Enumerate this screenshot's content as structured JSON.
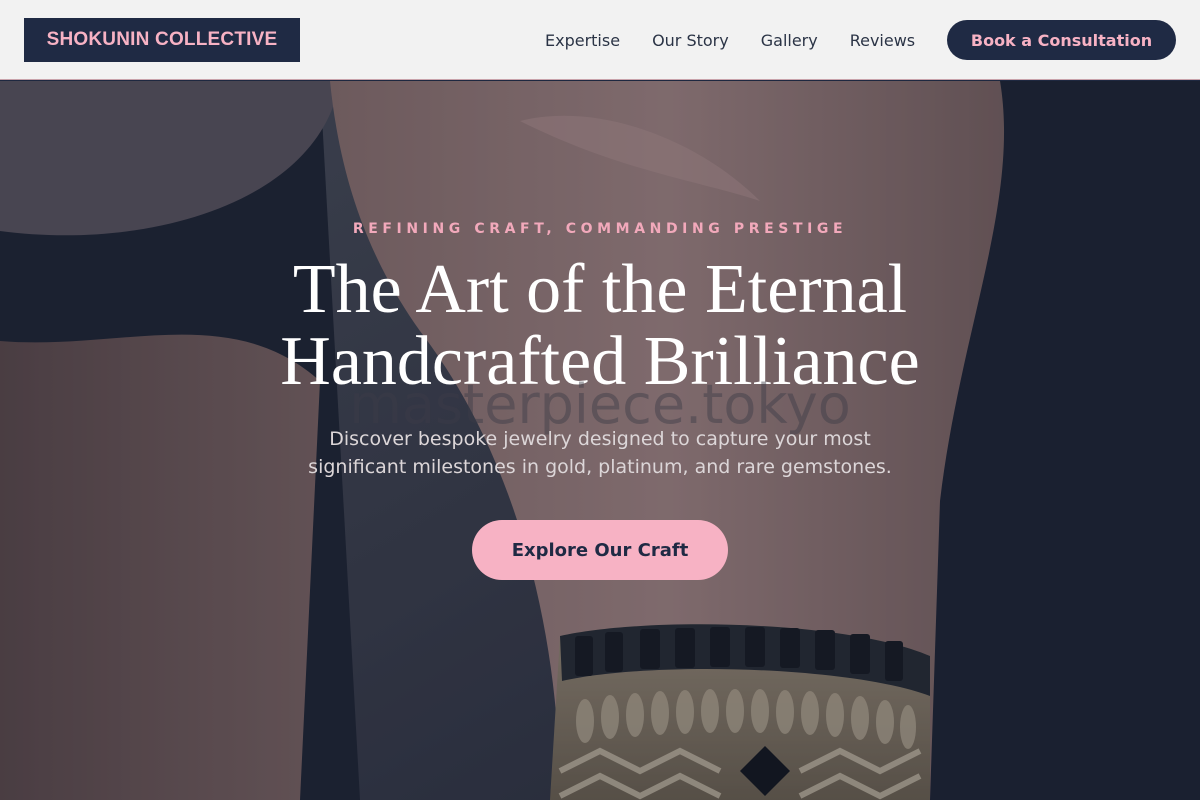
{
  "header": {
    "logo": "SHOKUNIN COLLECTIVE",
    "nav": [
      "Expertise",
      "Our Story",
      "Gallery",
      "Reviews"
    ],
    "cta": "Book a Consultation"
  },
  "hero": {
    "eyebrow": "REFINING CRAFT, COMMANDING PRESTIGE",
    "headline_line1": "The Art of the Eternal",
    "headline_line2": "Handcrafted Brilliance",
    "watermark": "masterpiece.tokyo",
    "subtitle_line1": "Discover bespoke jewelry designed to capture your most",
    "subtitle_line2": "significant milestones in gold, platinum, and rare gemstones.",
    "cta": "Explore Our Craft",
    "image_icon": "bracelet-wrist-photo"
  },
  "colors": {
    "navy": "#1f2a44",
    "pink": "#f7b2c4",
    "header_bg": "#f2f2f2"
  }
}
